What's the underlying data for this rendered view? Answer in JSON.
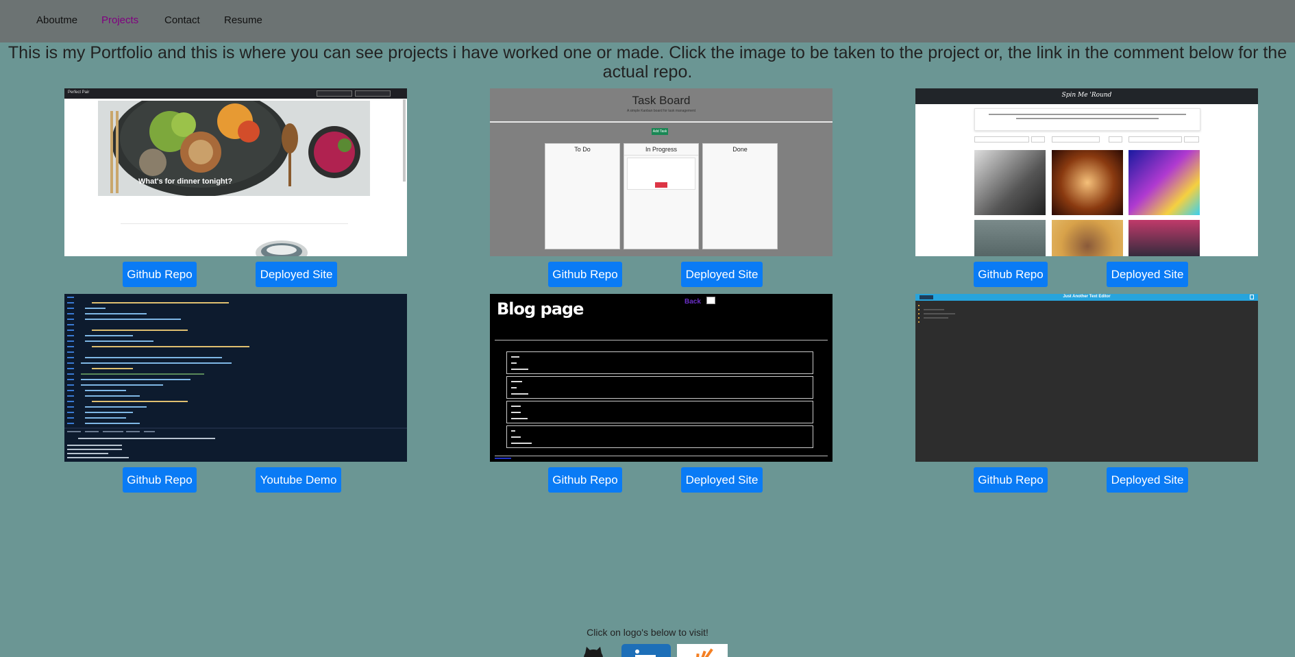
{
  "nav": {
    "items": [
      "Aboutme",
      "Projects",
      "Contact",
      "Resume"
    ],
    "active": "Projects"
  },
  "intro": "This is my Portfolio and this is where you can see projects i have worked one or made. Click the image to be taken to the project or, the link in the comment below for the actual repo.",
  "projects": [
    {
      "buttons": [
        "Github Repo",
        "Deployed Site"
      ],
      "screenshot": {
        "hero_caption": "What's for dinner tonight?"
      }
    },
    {
      "buttons": [
        "Github Repo",
        "Deployed Site"
      ],
      "screenshot": {
        "title": "Task Board",
        "subtitle": "A simple Kanban board for task management",
        "add_label": "Add Task",
        "columns": [
          "To Do",
          "In Progress",
          "Done"
        ]
      }
    },
    {
      "buttons": [
        "Github Repo",
        "Deployed Site"
      ],
      "screenshot": {
        "title": "Spin Me 'Round"
      }
    },
    {
      "buttons": [
        "Github Repo",
        "Youtube Demo"
      ],
      "screenshot": {}
    },
    {
      "buttons": [
        "Github Repo",
        "Deployed Site"
      ],
      "screenshot": {
        "title": "Blog page",
        "back_label": "Back"
      }
    },
    {
      "buttons": [
        "Github Repo",
        "Deployed Site"
      ],
      "screenshot": {
        "title": "Just Another Text Editor"
      }
    }
  ],
  "footer": {
    "text": "Click on logo's below to visit!"
  },
  "colors": {
    "page_bg": "#6b9694",
    "navbar_bg": "#6c7373",
    "nav_active": "#800080",
    "button": "#0a7bf5"
  },
  "icons": [
    "github-logo-icon",
    "linkedin-logo-icon",
    "stackoverflow-logo-icon"
  ]
}
